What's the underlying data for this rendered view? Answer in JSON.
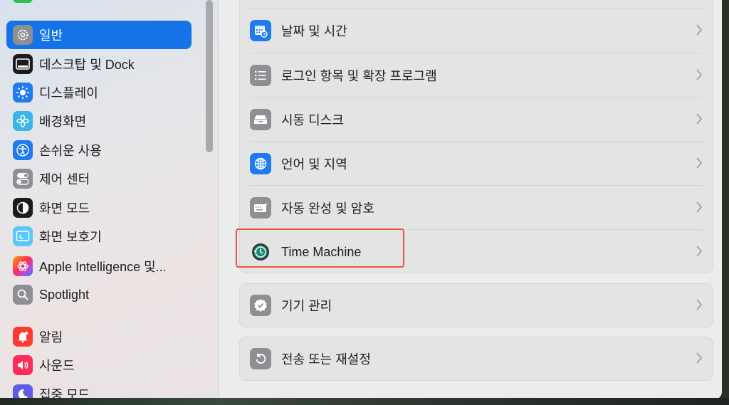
{
  "sidebar": {
    "items": [
      {
        "label": "일반",
        "icon": "gear-icon",
        "active": true
      },
      {
        "label": "데스크탑 및 Dock",
        "icon": "dock-icon"
      },
      {
        "label": "디스플레이",
        "icon": "sun-icon"
      },
      {
        "label": "배경화면",
        "icon": "flower-icon"
      },
      {
        "label": "손쉬운 사용",
        "icon": "accessibility-icon"
      },
      {
        "label": "제어 센터",
        "icon": "toggle-icon"
      },
      {
        "label": "화면 모드",
        "icon": "appearance-icon"
      },
      {
        "label": "화면 보호기",
        "icon": "screensaver-icon"
      },
      {
        "label": "Apple Intelligence 및...",
        "icon": "apple-intelligence-icon"
      },
      {
        "label": "Spotlight",
        "icon": "search-icon"
      },
      {
        "label": "알림",
        "icon": "bell-icon"
      },
      {
        "label": "사운드",
        "icon": "speaker-icon"
      },
      {
        "label": "집중 모드",
        "icon": "moon-icon"
      }
    ]
  },
  "main": {
    "group1": [
      {
        "label": "날짜 및 시간",
        "icon": "calendar-clock-icon"
      },
      {
        "label": "로그인 항목 및 확장 프로그램",
        "icon": "list-icon"
      },
      {
        "label": "시동 디스크",
        "icon": "disk-icon"
      },
      {
        "label": "언어 및 지역",
        "icon": "globe-icon"
      },
      {
        "label": "자동 완성 및 암호",
        "icon": "keyboard-icon"
      },
      {
        "label": "Time Machine",
        "icon": "time-machine-icon"
      }
    ],
    "group2": [
      {
        "label": "기기 관리",
        "icon": "badge-check-icon"
      }
    ],
    "group3": [
      {
        "label": "전송 또는 재설정",
        "icon": "reset-icon"
      }
    ]
  },
  "colors": {
    "accent": "#1473e6",
    "highlight": "#e8553a"
  }
}
